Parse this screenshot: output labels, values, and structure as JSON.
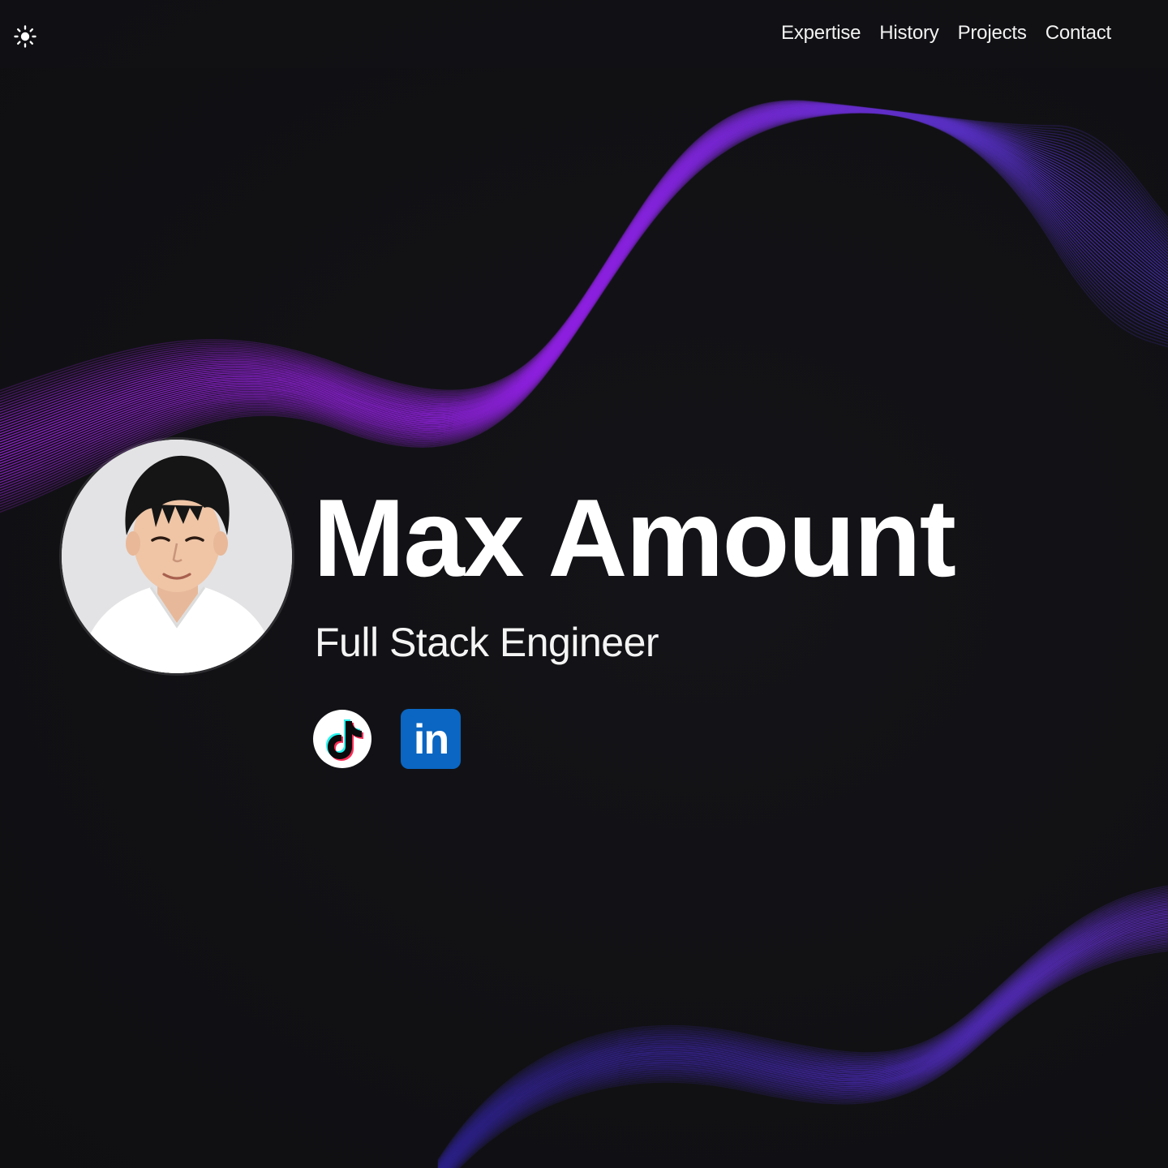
{
  "header": {
    "theme_toggle_icon": "sun-icon",
    "nav": [
      {
        "label": "Expertise"
      },
      {
        "label": "History"
      },
      {
        "label": "Projects"
      },
      {
        "label": "Contact"
      }
    ]
  },
  "hero": {
    "avatar_icon": "profile-photo",
    "name": "Max Amount",
    "role": "Full Stack Engineer",
    "social": [
      {
        "icon": "tiktok-icon"
      },
      {
        "icon": "linkedin-icon",
        "glyph": "in"
      }
    ]
  },
  "colors": {
    "background": "#111114",
    "wave_purple": "#8a1fd6",
    "wave_indigo": "#4b2bb5",
    "linkedin_blue": "#0a66c2",
    "text": "#ffffff"
  }
}
